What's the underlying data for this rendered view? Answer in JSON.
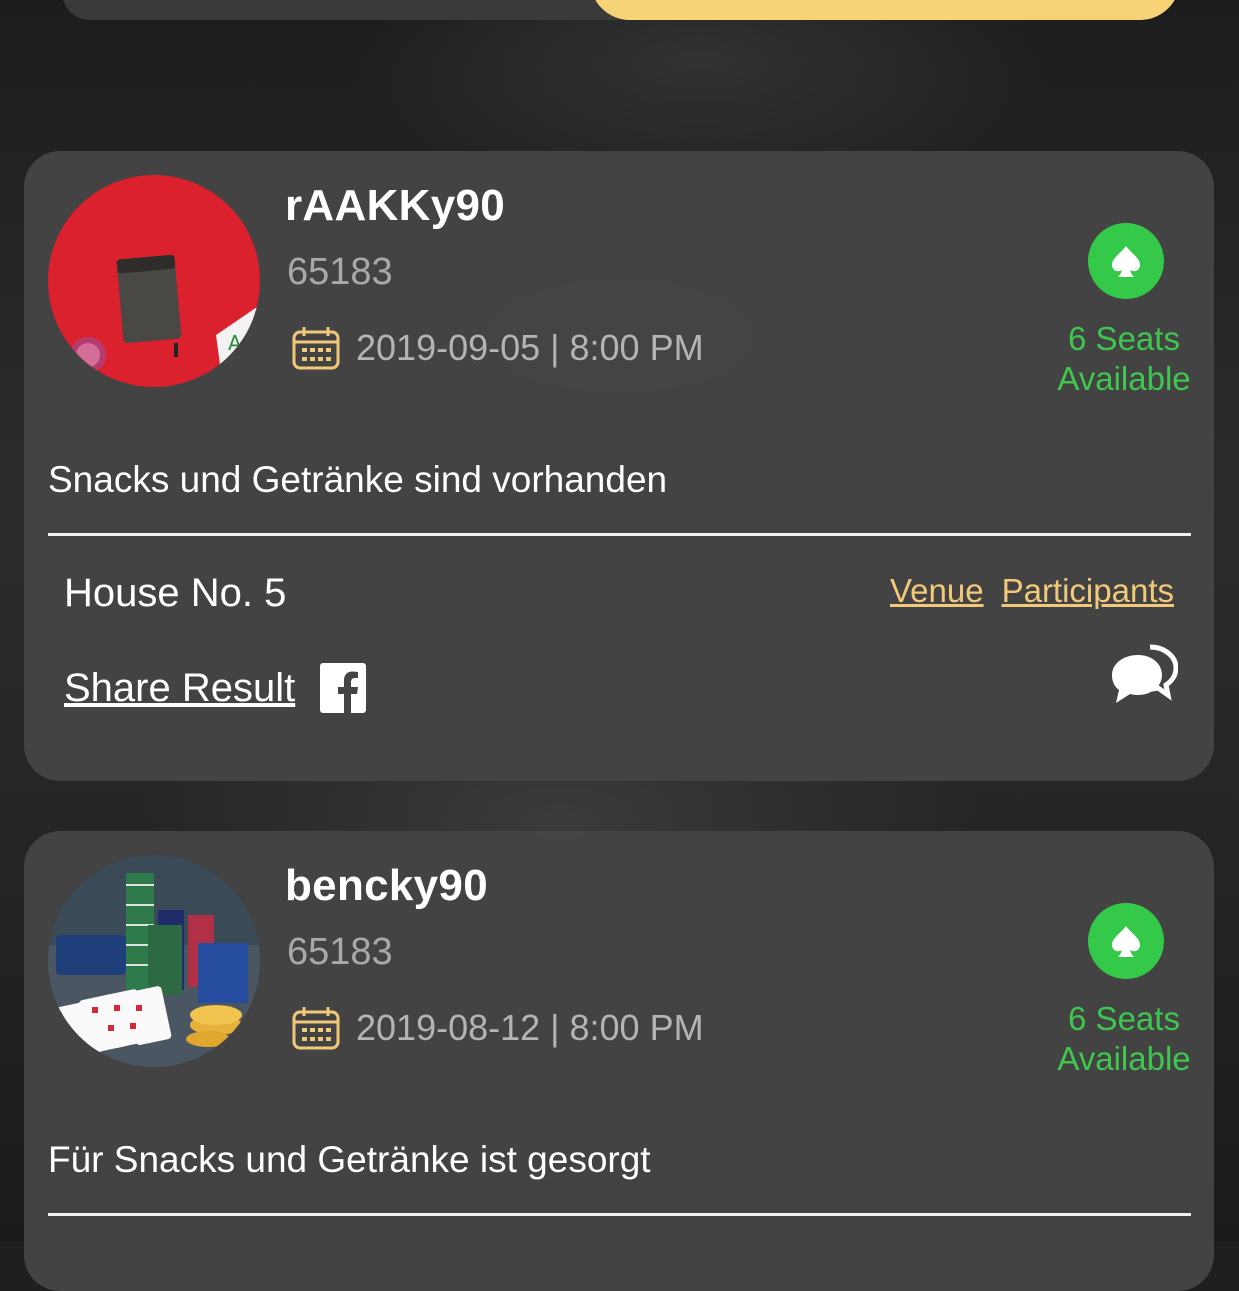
{
  "colors": {
    "accent_yellow": "#f5d376",
    "link_yellow": "#f1c978",
    "seats_green": "#3ec64f",
    "badge_green": "#35c94a",
    "card_bg": "#444444"
  },
  "games": [
    {
      "username": "rAAKKy90",
      "user_id": "65183",
      "datetime": "2019-09-05 | 8:00 PM",
      "seats": [
        "6 Seats",
        "Available"
      ],
      "description": "Snacks und Getränke sind vorhanden",
      "venue": "House No. 5",
      "venue_link": "Venue",
      "participants_link": "Participants",
      "share_label": "Share Result",
      "icons": [
        "calendar-icon",
        "spade-icon",
        "facebook-icon",
        "chat-bubbles-icon"
      ]
    },
    {
      "username": "bencky90",
      "user_id": "65183",
      "datetime": "2019-08-12 | 8:00 PM",
      "seats": [
        "6 Seats",
        "Available"
      ],
      "description": "Für Snacks und Getränke ist gesorgt",
      "icons": [
        "calendar-icon",
        "spade-icon"
      ]
    }
  ]
}
